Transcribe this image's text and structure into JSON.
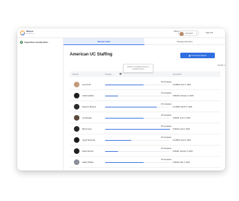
{
  "header": {
    "brand": "Mappio",
    "brand_sub": "Workstation",
    "office": "Office Assistant",
    "office_sub": "Your Office",
    "user": "Lisa Smith",
    "signout": "Sign Out"
  },
  "sidebar": {
    "items": [
      {
        "label": "Urgent Rare monthly Rules"
      }
    ]
  },
  "tabs": [
    {
      "label": "Member Stats",
      "active": true
    },
    {
      "label": "Manage Members",
      "active": false
    }
  ],
  "page": {
    "title": "American UC Staffing",
    "print_button": "Print Group Report",
    "sort_label": "Sort By"
  },
  "tooltip": {
    "line1": "Number of available protocols in",
    "line2": "completed course"
  },
  "table": {
    "columns": [
      "Member",
      "Progress",
      "Last Activity"
    ],
    "rows": [
      {
        "name": "Lisa Smith",
        "status": "3/5 Completed",
        "progress": 0.6,
        "activity": "12:49PM, April 1, 2020"
      },
      {
        "name": "Carla Gelidine",
        "status": "1/5 Completed",
        "progress": 0.2,
        "activity": "9:49AM, February 3, 2020"
      },
      {
        "name": "Kaybrun Bunteer",
        "status": "4/5 Completed",
        "progress": 0.8,
        "activity": "11:49AM, March 5, 2020"
      },
      {
        "name": "Lea Burgan",
        "status": "3/5 Completed",
        "progress": 0.6,
        "activity": "9:49AM, June 3, 2020"
      },
      {
        "name": "Mica Fouse",
        "status": "5/5 Completed",
        "progress": 1.0,
        "activity": "9:49AM, April 3, 2020"
      },
      {
        "name": "Angel Workman",
        "status": "2/5 Completed",
        "progress": 0.4,
        "activity": "12:49PM, April 3, 2020"
      },
      {
        "name": "Davie Demart",
        "status": "1/5 Completed",
        "progress": 0.2,
        "activity": "9:49AM, January 5, 2020"
      },
      {
        "name": "Jakob Phillips",
        "status": "3/5 Completed",
        "progress": 0.6,
        "activity": "9:49AM, May 3, 2020"
      }
    ]
  },
  "colors": {
    "accent": "#2f6fe0",
    "tab_active_bg": "#e6eefc",
    "bar_fill": "#3b72de",
    "bar_track": "#e7ebf3"
  },
  "icons": {
    "logo": "mappio-logo-icon",
    "print": "printer-icon",
    "info": "info-icon",
    "chevron": "chevron-down-icon"
  }
}
